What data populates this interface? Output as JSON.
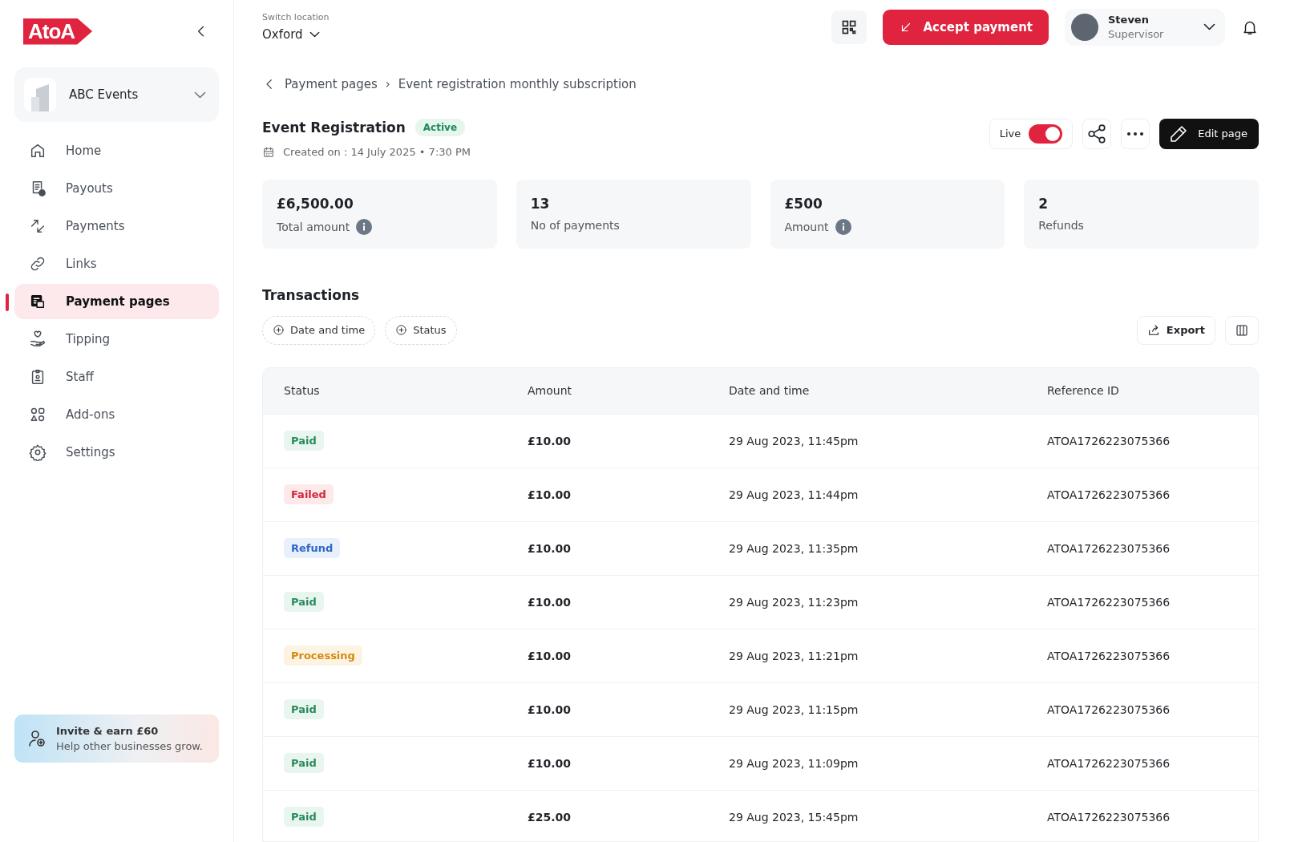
{
  "sidebar": {
    "logo": "AtoA",
    "business": {
      "name": "ABC Events"
    },
    "items": [
      {
        "label": "Home",
        "selected": false
      },
      {
        "label": "Payouts",
        "selected": false
      },
      {
        "label": "Payments",
        "selected": false
      },
      {
        "label": "Links",
        "selected": false
      },
      {
        "label": "Payment pages",
        "selected": true
      },
      {
        "label": "Tipping",
        "selected": false
      },
      {
        "label": "Staff",
        "selected": false
      },
      {
        "label": "Add-ons",
        "selected": false
      },
      {
        "label": "Settings",
        "selected": false
      }
    ],
    "promo": {
      "title": "Invite & earn £60",
      "text": "Help other businesses grow."
    }
  },
  "topbar": {
    "location_label": "Switch location",
    "location": "Oxford",
    "accept_button": "Accept payment",
    "user": {
      "name": "Steven",
      "role": "Supervisor"
    }
  },
  "breadcrumb": {
    "separator": "›",
    "items": [
      "Payment pages",
      "Event registration monthly subscription"
    ]
  },
  "page": {
    "title": "Event Registration",
    "status": "Active",
    "created": "Created on : 14 July 2025 • 7:30 PM",
    "live_label": "Live",
    "live": true,
    "edit_button": "Edit page"
  },
  "stats": [
    {
      "value": "£6,500.00",
      "label": "Total amount",
      "info": true
    },
    {
      "value": "13",
      "label": "No of payments",
      "info": false
    },
    {
      "value": "£500",
      "label": "Amount",
      "info": true
    },
    {
      "value": "2",
      "label": "Refunds",
      "info": false
    }
  ],
  "transactions": {
    "title": "Transactions",
    "filters": [
      "Date and time",
      "Status"
    ],
    "export_button": "Export",
    "columns": [
      "Status",
      "Amount",
      "Date and time",
      "Reference ID"
    ],
    "rows": [
      {
        "status": "Paid",
        "kind": "paid",
        "amount": "£10.00",
        "date": "29 Aug 2023, 11:45pm",
        "reference": "ATOA1726223075366"
      },
      {
        "status": "Failed",
        "kind": "failed",
        "amount": "£10.00",
        "date": "29 Aug 2023, 11:44pm",
        "reference": "ATOA1726223075366"
      },
      {
        "status": "Refund",
        "kind": "refund",
        "amount": "£10.00",
        "date": "29 Aug 2023, 11:35pm",
        "reference": "ATOA1726223075366"
      },
      {
        "status": "Paid",
        "kind": "paid",
        "amount": "£10.00",
        "date": "29 Aug 2023, 11:23pm",
        "reference": "ATOA1726223075366"
      },
      {
        "status": "Processing",
        "kind": "processing",
        "amount": "£10.00",
        "date": "29 Aug 2023, 11:21pm",
        "reference": "ATOA1726223075366"
      },
      {
        "status": "Paid",
        "kind": "paid",
        "amount": "£10.00",
        "date": "29 Aug 2023, 11:15pm",
        "reference": "ATOA1726223075366"
      },
      {
        "status": "Paid",
        "kind": "paid",
        "amount": "£10.00",
        "date": "29 Aug 2023, 11:09pm",
        "reference": "ATOA1726223075366"
      },
      {
        "status": "Paid",
        "kind": "paid",
        "amount": "£25.00",
        "date": "29 Aug 2023, 15:45pm",
        "reference": "ATOA1726223075366"
      }
    ]
  }
}
